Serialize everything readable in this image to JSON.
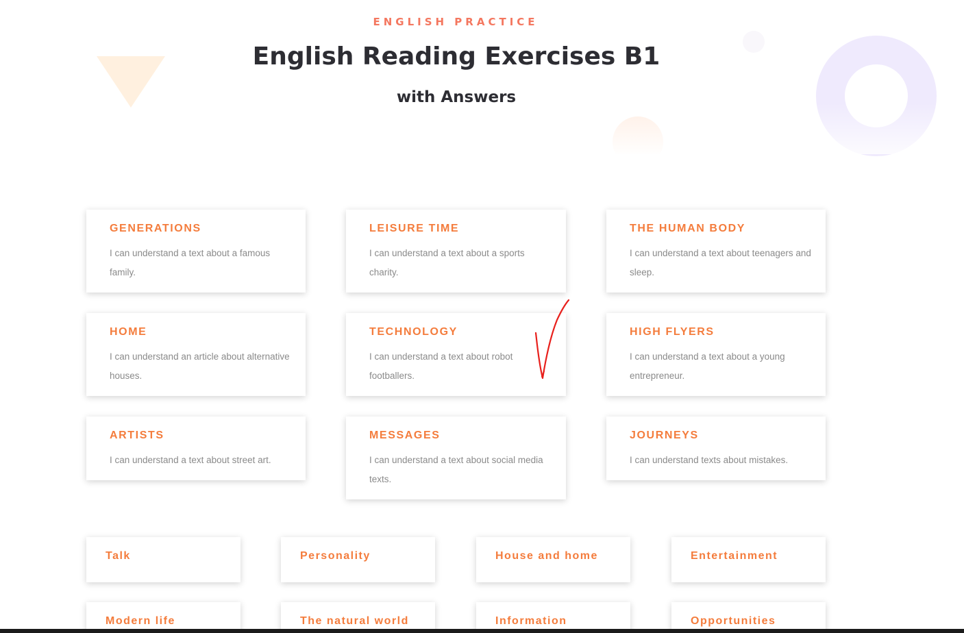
{
  "header": {
    "eyebrow": "ENGLISH PRACTICE",
    "title": "English Reading Exercises B1",
    "subtitle": "with Answers"
  },
  "cards": [
    {
      "title": "GENERATIONS",
      "desc": "I can understand a text about a famous family."
    },
    {
      "title": "LEISURE TIME",
      "desc": "I can understand a text about a sports charity."
    },
    {
      "title": "THE HUMAN BODY",
      "desc": "I can understand a text about teenagers and sleep."
    },
    {
      "title": "HOME",
      "desc": "I can understand an article about alternative houses."
    },
    {
      "title": "TECHNOLOGY",
      "desc": "I can understand a text about robot footballers."
    },
    {
      "title": "HIGH FLYERS",
      "desc": "I can understand a text about a young entrepreneur."
    },
    {
      "title": "ARTISTS",
      "desc": "I can understand a text about street art."
    },
    {
      "title": "MESSAGES",
      "desc": "I can understand a text about social media texts."
    },
    {
      "title": "JOURNEYS",
      "desc": "I can understand texts about mistakes."
    }
  ],
  "topics": [
    {
      "label": "Talk"
    },
    {
      "label": "Personality"
    },
    {
      "label": "House and home"
    },
    {
      "label": "Entertainment"
    },
    {
      "label": "Modern life"
    },
    {
      "label": "The natural world"
    },
    {
      "label": "Information"
    },
    {
      "label": "Opportunities"
    }
  ],
  "annotation": {
    "mark": "check-mark",
    "color": "#e8201c"
  },
  "colors": {
    "accent": "#f47c3c",
    "eyebrow": "#f4775f",
    "heading": "#2d2d33",
    "body_text": "#8a8a8a"
  }
}
